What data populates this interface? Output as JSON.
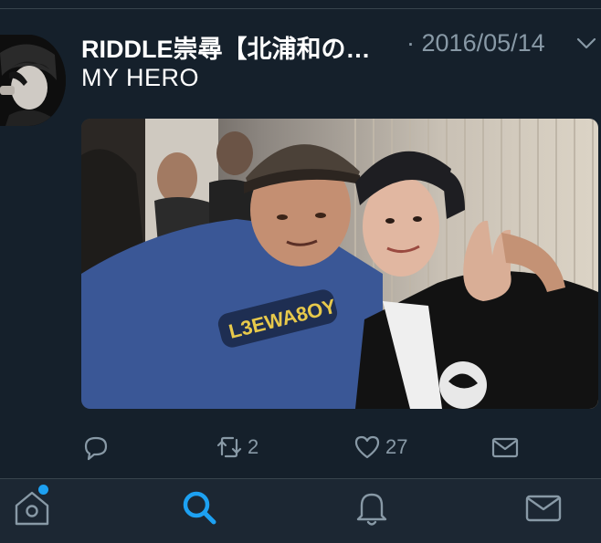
{
  "tweet": {
    "author_name": "RIDDLE崇尋【北浦和の…",
    "separator": "·",
    "date": "2016/05/14",
    "text": "MY HERO",
    "photo_shirt_print": "L3EWA8OY"
  },
  "actions": {
    "reply_count": "",
    "retweet_count": "2",
    "like_count": "27"
  },
  "tabbar": {
    "home_has_notification": true,
    "active_tab": "search"
  },
  "colors": {
    "background": "#15202b",
    "tabbar_background": "#1c2733",
    "text_primary": "#ffffff",
    "text_secondary": "#8899a6",
    "accent": "#1da1f2"
  },
  "icons": [
    "chevron-down-icon",
    "reply-icon",
    "retweet-icon",
    "like-icon",
    "share-mail-icon",
    "home-icon",
    "search-icon",
    "notifications-bell-icon",
    "messages-mail-icon"
  ]
}
